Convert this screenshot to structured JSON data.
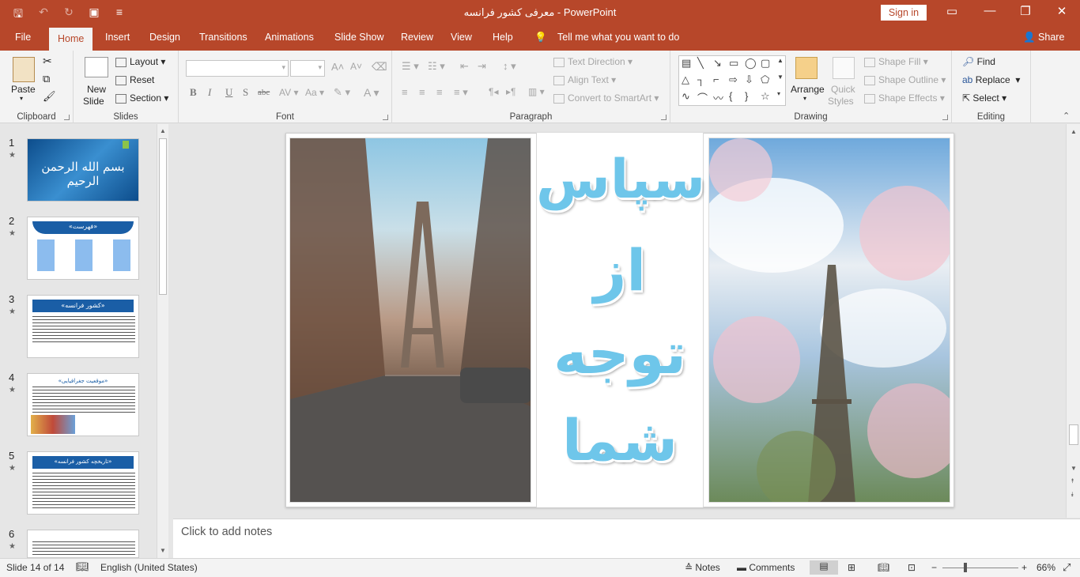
{
  "app": {
    "window_title": "معرفی کشور فرانسه  -  PowerPoint",
    "sign_in": "Sign in",
    "colors": {
      "accent": "#b7472a",
      "farsi_text": "#6ec6ea",
      "ribbon_bg": "#f3f3f3"
    }
  },
  "tabs": [
    "File",
    "Home",
    "Insert",
    "Design",
    "Transitions",
    "Animations",
    "Slide Show",
    "Review",
    "View",
    "Help"
  ],
  "active_tab": "Home",
  "tell_me": "Tell me what you want to do",
  "share": "Share",
  "ribbon": {
    "clipboard": {
      "paste": "Paste",
      "label": "Clipboard"
    },
    "slides": {
      "new_slide_1": "New",
      "new_slide_2": "Slide",
      "layout": "Layout",
      "reset": "Reset",
      "section": "Section",
      "label": "Slides"
    },
    "font": {
      "label": "Font",
      "bold": "B",
      "italic": "I",
      "underline": "U",
      "shadow": "S",
      "strike": "abc"
    },
    "paragraph": {
      "label": "Paragraph",
      "text_direction": "Text Direction",
      "align_text": "Align Text",
      "convert_smartart": "Convert to SmartArt"
    },
    "drawing": {
      "label": "Drawing",
      "arrange": "Arrange",
      "quick_styles_1": "Quick",
      "quick_styles_2": "Styles",
      "shape_fill": "Shape Fill",
      "shape_outline": "Shape Outline",
      "shape_effects": "Shape Effects"
    },
    "editing": {
      "label": "Editing",
      "find": "Find",
      "replace": "Replace",
      "select": "Select"
    }
  },
  "thumbnails": [
    {
      "num": "1",
      "title": "بسم الله الرحمن الرحیم"
    },
    {
      "num": "2",
      "title": "«فهرست»"
    },
    {
      "num": "3",
      "title": "«کشور فرانسه»"
    },
    {
      "num": "4",
      "title": "«موقعیت جغرافیایی»"
    },
    {
      "num": "5",
      "title": "«تاریخچه کشور فرانسه»"
    },
    {
      "num": "6",
      "title": ""
    }
  ],
  "slide": {
    "line1": "سپاس",
    "line2": "از",
    "line3": "توجه",
    "line4": "شما"
  },
  "notes_placeholder": "Click to add notes",
  "status": {
    "slide_info": "Slide 14 of 14",
    "language": "English (United States)",
    "notes": "Notes",
    "comments": "Comments",
    "zoom": "66%"
  }
}
